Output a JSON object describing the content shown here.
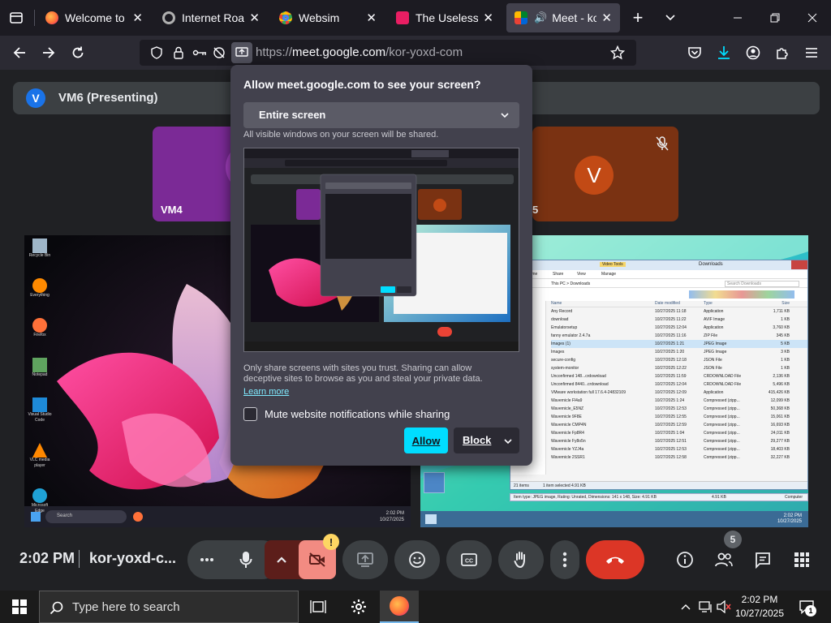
{
  "browser": {
    "tabs": [
      {
        "title": "Welcome to Fire",
        "favicon": "firefox-icon",
        "color": "#ff7139"
      },
      {
        "title": "Internet Roadtrip",
        "favicon": "settings-icon",
        "color": "#9e9e9e"
      },
      {
        "title": "Websim",
        "favicon": "chrome-icon",
        "color": "#4285f4"
      },
      {
        "title": "The Useless Web",
        "favicon": "useless-web-icon",
        "color": "#e91e63"
      },
      {
        "title": "Meet - kor-",
        "favicon": "meet-icon",
        "color": "#00897b",
        "active": true
      }
    ],
    "new_tab_label": "+",
    "tab_list_label": "⌄",
    "url_domain": "meet.google.com",
    "url_prefix": "https://",
    "url_path": "/kor-yoxd-com"
  },
  "meet": {
    "presenting_label": "VM6 (Presenting)",
    "presenting_initial": "V",
    "tiles": [
      {
        "label": "VM4"
      },
      {
        "label": "V"
      },
      {
        "label": "5"
      }
    ],
    "time": "2:02 PM",
    "meeting_code": "kor-yoxd-c...",
    "participants_count": "5",
    "warning_badge": "!"
  },
  "dialog": {
    "title": "Allow meet.google.com to see your screen?",
    "select_value": "Entire screen",
    "hint": "All visible windows on your screen will be shared.",
    "warning": "Only share screens with sites you trust. Sharing can allow deceptive sites to browse as you and steal your private data.",
    "learn_more": "Learn more",
    "mute_label": "Mute website notifications while sharing",
    "allow_label": "Allow",
    "block_label": "Block"
  },
  "shared_screen": {
    "window_title": "Downloads",
    "ribbon_label": "Video Tools",
    "ribbon_tabs": [
      "Home",
      "Share",
      "View",
      "Manage"
    ],
    "breadcrumb": "This PC > Downloads",
    "search_placeholder": "Search Downloads",
    "columns": [
      "Name",
      "Date modified",
      "Type",
      "Size"
    ],
    "files": [
      {
        "name": "Any Record",
        "date": "10/27/2025 11:18",
        "type": "Application",
        "size": "1,711 KB"
      },
      {
        "name": "download",
        "date": "10/27/2025 11:22",
        "type": "AVIF Image",
        "size": "1 KB"
      },
      {
        "name": "Emulatorsetup",
        "date": "10/27/2025 12:04",
        "type": "Application",
        "size": "3,760 KB"
      },
      {
        "name": "fanny emulator 2.4.7a",
        "date": "10/27/2025 11:16",
        "type": "ZIP File",
        "size": "345 KB"
      },
      {
        "name": "Images (1)",
        "date": "10/27/2025 1:21",
        "type": "JPEG Image",
        "size": "5 KB"
      },
      {
        "name": "Images",
        "date": "10/27/2025 1:20",
        "type": "JPEG Image",
        "size": "3 KB"
      },
      {
        "name": "secure-config",
        "date": "10/27/2025 12:18",
        "type": "JSON File",
        "size": "1 KB"
      },
      {
        "name": "system-monitor",
        "date": "10/27/2025 12:22",
        "type": "JSON File",
        "size": "1 KB"
      },
      {
        "name": "Unconfirmed 148...crdownload",
        "date": "10/27/2025 11:59",
        "type": "CRDOWNLOAD File",
        "size": "2,136 KB"
      },
      {
        "name": "Unconfirmed 8440...crdownload",
        "date": "10/27/2025 12:04",
        "type": "CRDOWNLOAD File",
        "size": "5,496 KB"
      },
      {
        "name": "VMware workstation full 17.6.4-24832109",
        "date": "10/27/2025 12:09",
        "type": "Application",
        "size": "415,426 KB"
      },
      {
        "name": "Wavernicle Fl4a9",
        "date": "10/27/2025 1:24",
        "type": "Compressed (zipp...",
        "size": "12,099 KB"
      },
      {
        "name": "Wavernicle_E5NZ",
        "date": "10/27/2025 12:53",
        "type": "Compressed (zipp...",
        "size": "50,368 KB"
      },
      {
        "name": "Wavernicle 9F8E",
        "date": "10/27/2025 12:55",
        "type": "Compressed (zipp...",
        "size": "15,061 KB"
      },
      {
        "name": "Wavernicle CMP4N",
        "date": "10/27/2025 12:59",
        "type": "Compressed (zipp...",
        "size": "16,693 KB"
      },
      {
        "name": "Wavernicle Fp8R4",
        "date": "10/27/2025 1:04",
        "type": "Compressed (zipp...",
        "size": "24,011 KB"
      },
      {
        "name": "Wavernicle Fy8o5n",
        "date": "10/27/2025 12:51",
        "type": "Compressed (zipp...",
        "size": "29,277 KB"
      },
      {
        "name": "Wavernicle YZJ4a",
        "date": "10/27/2025 12:53",
        "type": "Compressed (zipp...",
        "size": "18,403 KB"
      },
      {
        "name": "Wavernicle 2SSR1",
        "date": "10/27/2025 12:58",
        "type": "Compressed (zipp...",
        "size": "32,227 KB"
      }
    ],
    "status_items": "21 items",
    "status_selected": "1 item selected  4.91 KB",
    "status_info": "Item type: JPEG image, Rating: Unrated, Dimensions: 141 x 148, Size: 4.91 KB",
    "status_size": "4.91 KB",
    "status_location": "Computer",
    "vm_clock_time": "2:02 PM",
    "vm_clock_date": "10/27/2025",
    "vm_search": "Search",
    "desktop_icons": [
      "Recycle Bin",
      "Everything",
      "Firefox",
      "Notepad",
      "Visual Studio Code",
      "VLC media player",
      "Microsoft Edge"
    ]
  },
  "taskbar": {
    "search_placeholder": "Type here to search",
    "time": "2:02 PM",
    "date": "10/27/2025",
    "notification_count": "1"
  }
}
